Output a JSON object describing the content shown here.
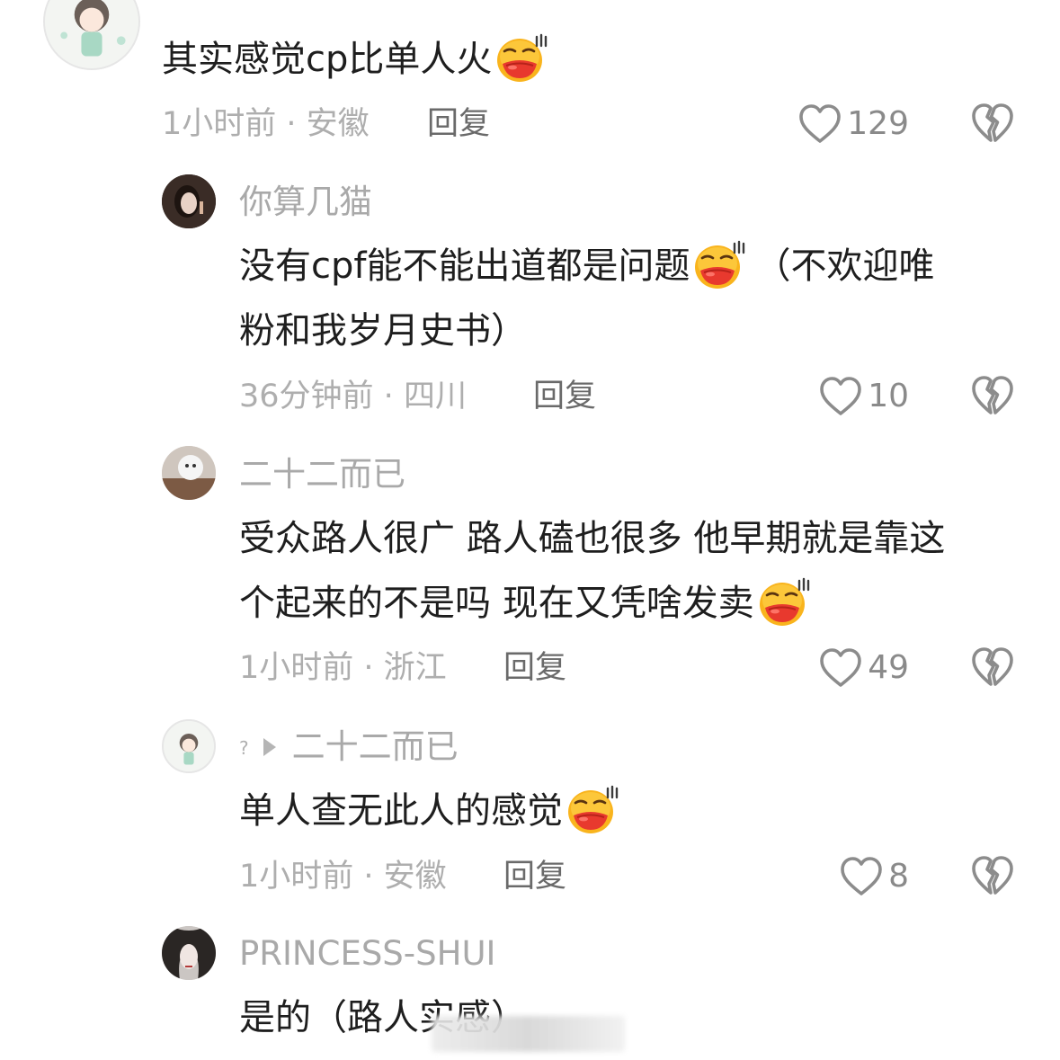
{
  "comments": [
    {
      "username": "",
      "content_lines": [
        "其实感觉cp比单人火"
      ],
      "emoji": "smirk-emoji",
      "time": "1小时前",
      "location": "安徽",
      "reply_label": "回复",
      "likes": "129"
    },
    {
      "username": "你算几猫",
      "content_lines": [
        "没有cpf能不能出道都是问题",
        "（不欢迎唯",
        "粉和我岁月史书）"
      ],
      "emoji": "smirk-emoji",
      "time": "36分钟前",
      "location": "四川",
      "reply_label": "回复",
      "likes": "10"
    },
    {
      "username": "二十二而已",
      "content_lines": [
        "受众路人很广 路人磕也很多 他早期就是靠这",
        "个起来的不是吗 现在又凭啥发卖"
      ],
      "emoji": "smirk-emoji",
      "time": "1小时前",
      "location": "浙江",
      "reply_label": "回复",
      "likes": "49"
    },
    {
      "username_tag": "?",
      "reply_to": "二十二而已",
      "content_lines": [
        "单人查无此人的感觉"
      ],
      "emoji": "smirk-emoji",
      "time": "1小时前",
      "location": "安徽",
      "reply_label": "回复",
      "likes": "8"
    },
    {
      "username": "PRINCESS-SHUI",
      "content_lines": [
        "是的（路人实感）"
      ]
    }
  ],
  "separator": " · ",
  "icons": {
    "like": "heart-outline-icon",
    "dislike": "broken-heart-icon",
    "reply_to": "play-arrow-icon"
  },
  "colors": {
    "text_primary": "#1e1e1e",
    "text_secondary": "#a9a9a9",
    "reply": "#6a6a6a",
    "emoji_face": "#f7a21b",
    "emoji_mouth": "#e8392e"
  }
}
